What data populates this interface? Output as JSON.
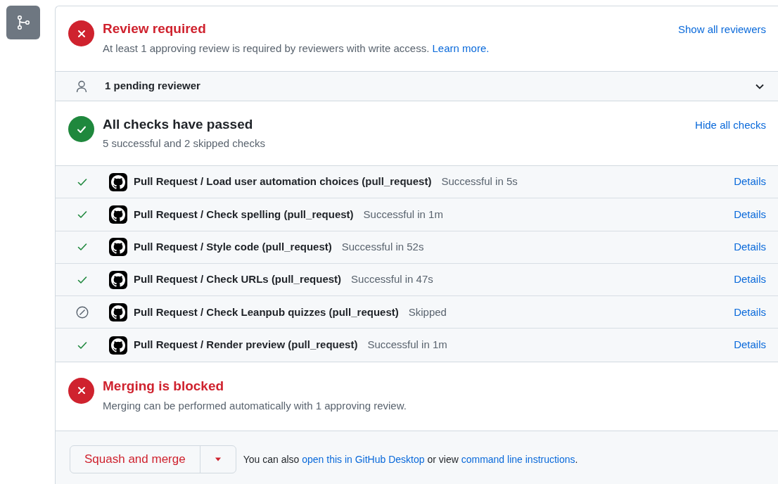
{
  "review": {
    "kind": "failure",
    "title": "Review required",
    "description": "At least 1 approving review is required by reviewers with write access.",
    "link": "Learn more.",
    "action": "Show all reviewers"
  },
  "pending": {
    "label": "1 pending reviewer",
    "expanded": false
  },
  "checks": {
    "kind": "success",
    "title": "All checks have passed",
    "summary": "5 successful and 2 skipped checks",
    "action": "Hide all checks",
    "rows": [
      {
        "kind": "success",
        "name": "Pull Request / Load user automation choices (pull_request)",
        "result": "Successful in 5s",
        "link": "Details"
      },
      {
        "kind": "success",
        "name": "Pull Request / Check spelling (pull_request)",
        "result": "Successful in 1m",
        "link": "Details"
      },
      {
        "kind": "success",
        "name": "Pull Request / Style code (pull_request)",
        "result": "Successful in 52s",
        "link": "Details"
      },
      {
        "kind": "success",
        "name": "Pull Request / Check URLs (pull_request)",
        "result": "Successful in 47s",
        "link": "Details"
      },
      {
        "kind": "skipped",
        "name": "Pull Request / Check Leanpub quizzes (pull_request)",
        "result": "Skipped",
        "link": "Details"
      },
      {
        "kind": "success",
        "name": "Pull Request / Render preview (pull_request)",
        "result": "Successful in 1m",
        "link": "Details"
      }
    ]
  },
  "merge": {
    "kind": "failure",
    "title": "Merging is blocked",
    "description": "Merging can be performed automatically with 1 approving review."
  },
  "footer": {
    "button": "Squash and merge",
    "text_before": "You can also",
    "link_1": "open this in GitHub Desktop",
    "text_middle": "or view",
    "link_2": "command line instructions",
    "text_after": "."
  }
}
